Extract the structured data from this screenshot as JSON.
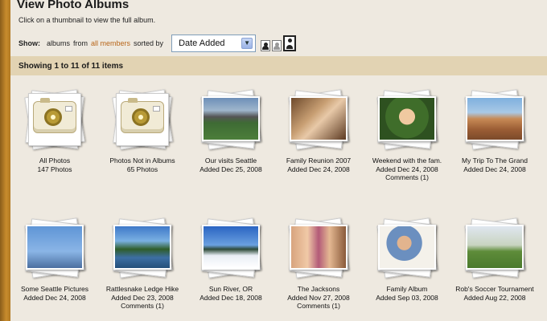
{
  "page": {
    "title": "View Photo Albums",
    "subtitle": "Click on a thumbnail to view the full album."
  },
  "filter": {
    "show_label": "Show:",
    "type": "albums",
    "from_word": "from",
    "members_link": "all members",
    "sorted_by": "sorted by",
    "sort_value": "Date Added",
    "view_icons": [
      "person-small-icon",
      "person-medium-icon",
      "person-large-icon"
    ]
  },
  "status": {
    "text": "Showing 1 to 11 of 11 items"
  },
  "colors": {
    "background": "#eee9e0",
    "status_bar": "#e2d3b3",
    "left_bar": "#c88c2d",
    "link": "#b8661a"
  },
  "albums": [
    {
      "name": "All Photos",
      "meta": "147 Photos",
      "comments": "",
      "icon": "camera-icon"
    },
    {
      "name": "Photos Not in Albums",
      "meta": "65 Photos",
      "comments": "",
      "icon": "camera-icon"
    },
    {
      "name": "Our visits Seattle",
      "meta": "Added Dec 25, 2008",
      "comments": "",
      "icon": "stadium-photo"
    },
    {
      "name": "Family Reunion 2007",
      "meta": "Added Dec 24, 2008",
      "comments": "",
      "icon": "family-photo"
    },
    {
      "name": "Weekend with the fam.",
      "meta": "Added Dec 24, 2008",
      "comments": "Comments (1)",
      "icon": "child-photo"
    },
    {
      "name": "My Trip To The Grand",
      "meta": "Added Dec 24, 2008",
      "comments": "",
      "icon": "canyon-photo"
    },
    {
      "name": "Some Seattle Pictures",
      "meta": "Added Dec 24, 2008",
      "comments": "",
      "icon": "space-needle-photo"
    },
    {
      "name": "Rattlesnake Ledge Hike",
      "meta": "Added Dec 23, 2008",
      "comments": "Comments (1)",
      "icon": "lake-photo"
    },
    {
      "name": "Sun River, OR",
      "meta": "Added Dec 18, 2008",
      "comments": "",
      "icon": "snow-photo"
    },
    {
      "name": "The Jacksons",
      "meta": "Added Nov 27, 2008",
      "comments": "Comments (1)",
      "icon": "girls-photo"
    },
    {
      "name": "Family Album",
      "meta": "Added Sep 03, 2008",
      "comments": "",
      "icon": "man-photo"
    },
    {
      "name": "Rob's Soccer Tournament",
      "meta": "Added Aug 22, 2008",
      "comments": "",
      "icon": "soccer-photo"
    }
  ]
}
